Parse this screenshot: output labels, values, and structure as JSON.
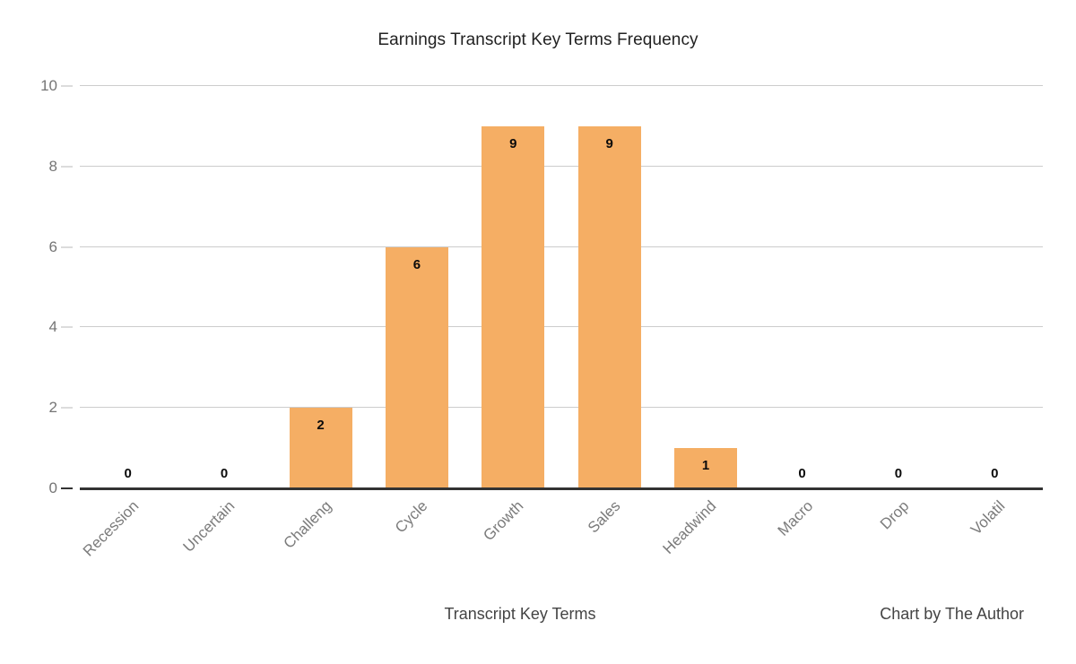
{
  "chart_data": {
    "type": "bar",
    "title": "Earnings Transcript Key Terms Frequency",
    "xlabel": "Transcript Key Terms",
    "ylabel": "",
    "ylim": [
      0,
      10
    ],
    "yticks": [
      0,
      2,
      4,
      6,
      8,
      10
    ],
    "grid": true,
    "legend": false,
    "bar_color": "#f5ae64",
    "data_labels": true,
    "annotation": "Chart by The Author",
    "categories": [
      "Recession",
      "Uncertain",
      "Challeng",
      "Cycle",
      "Growth",
      "Sales",
      "Headwind",
      "Macro",
      "Drop",
      "Volatil"
    ],
    "values": [
      0,
      0,
      2,
      6,
      9,
      9,
      1,
      0,
      0,
      0
    ],
    "value_labels": [
      "0",
      "0",
      "2",
      "6",
      "9",
      "9",
      "1",
      "0",
      "0",
      "0"
    ],
    "ytick_labels": [
      "0",
      "2",
      "4",
      "6",
      "8",
      "10"
    ]
  },
  "colors": {
    "bar": "#f5ae64",
    "grid": "#cccccc",
    "axis": "#333333",
    "tick_text": "#757575",
    "category_text": "#7b7b7b",
    "title_text": "#222222",
    "footer_text": "#444444",
    "background": "#ffffff"
  }
}
